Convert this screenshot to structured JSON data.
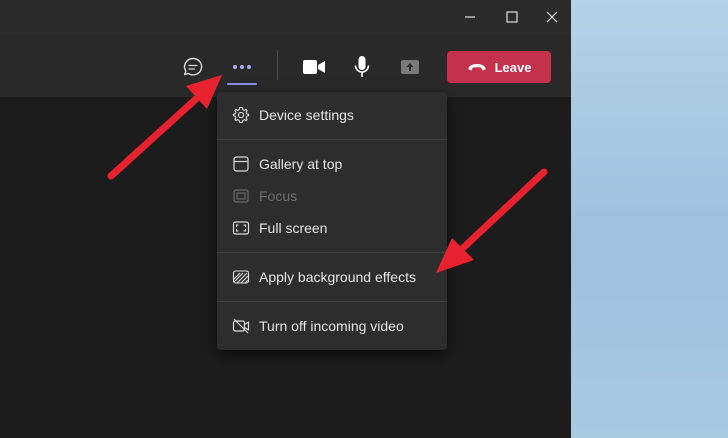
{
  "toolbar": {
    "leave_label": "Leave"
  },
  "menu": {
    "items": [
      {
        "label": "Device settings",
        "icon": "gear-icon",
        "enabled": true
      },
      {
        "label": "Gallery at top",
        "icon": "gallery-icon",
        "enabled": true
      },
      {
        "label": "Focus",
        "icon": "focus-icon",
        "enabled": false
      },
      {
        "label": "Full screen",
        "icon": "fullscreen-icon",
        "enabled": true
      },
      {
        "label": "Apply background effects",
        "icon": "background-effects-icon",
        "enabled": true
      },
      {
        "label": "Turn off incoming video",
        "icon": "video-off-icon",
        "enabled": true
      }
    ]
  },
  "colors": {
    "leave_button": "#c4314b",
    "active_indicator": "#8b8fe8",
    "annotation_arrow": "#e8212f"
  }
}
